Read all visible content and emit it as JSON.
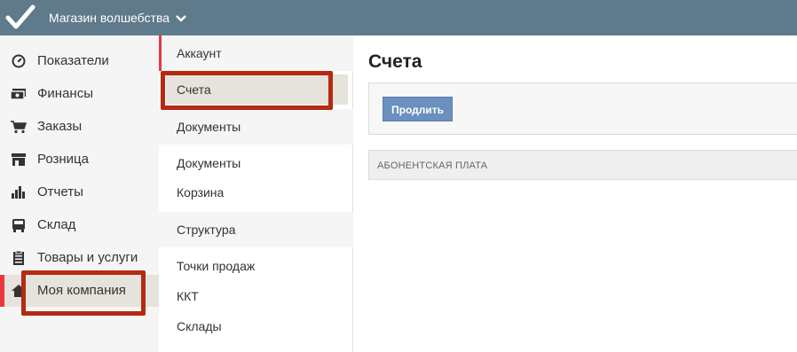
{
  "topbar": {
    "store_name": "Магазин волшебства",
    "accent_color": "#5f7a8a"
  },
  "sidebar": {
    "items": [
      {
        "label": "Показатели",
        "icon": "dashboard-icon"
      },
      {
        "label": "Финансы",
        "icon": "money-icon"
      },
      {
        "label": "Заказы",
        "icon": "cart-icon"
      },
      {
        "label": "Розница",
        "icon": "store-icon"
      },
      {
        "label": "Отчеты",
        "icon": "bar-chart-icon"
      },
      {
        "label": "Склад",
        "icon": "warehouse-icon"
      },
      {
        "label": "Товары и услуги",
        "icon": "clipboard-icon"
      },
      {
        "label": "Моя компания",
        "icon": "home-icon",
        "active": true
      }
    ]
  },
  "submenu": {
    "groups": [
      {
        "title": "Аккаунт",
        "items": [
          "Счета"
        ]
      },
      {
        "title": "Документы",
        "items": [
          "Документы",
          "Корзина"
        ]
      },
      {
        "title": "Структура",
        "items": [
          "Точки продаж",
          "ККТ",
          "Склады"
        ]
      }
    ],
    "selected": "Счета"
  },
  "main": {
    "title": "Счета",
    "renew_button": "Продлить",
    "section_label": "АБОНЕНТСКАЯ ПЛАТА"
  },
  "colors": {
    "active_bg": "#e6e3dc",
    "accent_red": "#e8383d",
    "highlight": "#b52a11",
    "button_blue": "#6b8fbe"
  }
}
